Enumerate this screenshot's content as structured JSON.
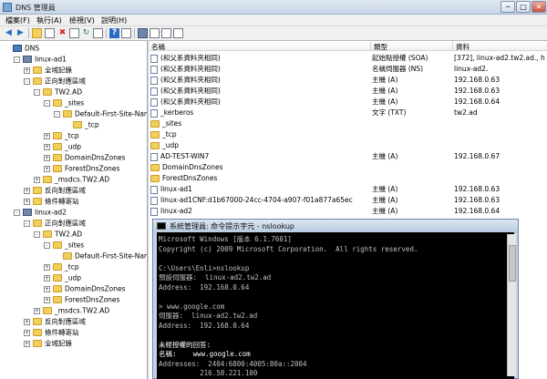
{
  "window": {
    "title": "DNS 管理員",
    "min": "─",
    "max": "□",
    "close": "✕"
  },
  "menu": [
    "檔案(F)",
    "執行(A)",
    "檢視(V)",
    "說明(H)"
  ],
  "toolbar_icons": [
    "back-arrow",
    "forward-arrow",
    "up-folder",
    "show-tree",
    "delete",
    "properties",
    "refresh",
    "export",
    "help",
    "help2",
    "server",
    "doc",
    "doc2",
    "doc3"
  ],
  "tree": [
    {
      "depth": 0,
      "exp": "",
      "icon": "dns",
      "label": "DNS"
    },
    {
      "depth": 1,
      "exp": "-",
      "icon": "server",
      "label": "linux-ad1"
    },
    {
      "depth": 2,
      "exp": "+",
      "icon": "folder",
      "label": "全域記錄"
    },
    {
      "depth": 2,
      "exp": "-",
      "icon": "folder",
      "label": "正向對應區域"
    },
    {
      "depth": 3,
      "exp": "-",
      "icon": "folder",
      "label": "TW2.AD"
    },
    {
      "depth": 4,
      "exp": "-",
      "icon": "folder",
      "label": "_sites"
    },
    {
      "depth": 5,
      "exp": "-",
      "icon": "folder",
      "label": "Default-First-Site-Name"
    },
    {
      "depth": 6,
      "exp": "",
      "icon": "folder",
      "label": "_tcp"
    },
    {
      "depth": 4,
      "exp": "+",
      "icon": "folder",
      "label": "_tcp"
    },
    {
      "depth": 4,
      "exp": "+",
      "icon": "folder",
      "label": "_udp"
    },
    {
      "depth": 4,
      "exp": "+",
      "icon": "folder",
      "label": "DomainDnsZones"
    },
    {
      "depth": 4,
      "exp": "+",
      "icon": "folder",
      "label": "ForestDnsZones"
    },
    {
      "depth": 3,
      "exp": "+",
      "icon": "folder",
      "label": "_msdcs.TW2.AD"
    },
    {
      "depth": 2,
      "exp": "+",
      "icon": "folder",
      "label": "反向對應區域"
    },
    {
      "depth": 2,
      "exp": "+",
      "icon": "folder",
      "label": "條件轉寄站"
    },
    {
      "depth": 1,
      "exp": "-",
      "icon": "server",
      "label": "linux-ad2"
    },
    {
      "depth": 2,
      "exp": "-",
      "icon": "folder",
      "label": "正向對應區域"
    },
    {
      "depth": 3,
      "exp": "-",
      "icon": "folder",
      "label": "TW2.AD"
    },
    {
      "depth": 4,
      "exp": "-",
      "icon": "folder",
      "label": "_sites"
    },
    {
      "depth": 5,
      "exp": "",
      "icon": "folder",
      "label": "Default-First-Site-Name"
    },
    {
      "depth": 4,
      "exp": "+",
      "icon": "folder",
      "label": "_tcp"
    },
    {
      "depth": 4,
      "exp": "+",
      "icon": "folder",
      "label": "_udp"
    },
    {
      "depth": 4,
      "exp": "+",
      "icon": "folder",
      "label": "DomainDnsZones"
    },
    {
      "depth": 4,
      "exp": "+",
      "icon": "folder",
      "label": "ForestDnsZones"
    },
    {
      "depth": 3,
      "exp": "+",
      "icon": "folder",
      "label": "_msdcs.TW2.AD"
    },
    {
      "depth": 2,
      "exp": "+",
      "icon": "folder",
      "label": "反向對應區域"
    },
    {
      "depth": 2,
      "exp": "+",
      "icon": "folder",
      "label": "條件轉寄站"
    },
    {
      "depth": 2,
      "exp": "+",
      "icon": "folder",
      "label": "全域記錄"
    }
  ],
  "columns": {
    "name": "名稱",
    "type": "類型",
    "data": "資料"
  },
  "records": [
    {
      "icon": "record",
      "name": "(和父系資料夾相同)",
      "type": "起始點授權 (SOA)",
      "data": "[372], linux-ad2.tw2.ad., h"
    },
    {
      "icon": "record",
      "name": "(和父系資料夾相同)",
      "type": "名稱伺服器 (NS)",
      "data": "linux-ad2."
    },
    {
      "icon": "record",
      "name": "(和父系資料夾相同)",
      "type": "主機 (A)",
      "data": "192.168.0.63"
    },
    {
      "icon": "record",
      "name": "(和父系資料夾相同)",
      "type": "主機 (A)",
      "data": "192.168.0.63"
    },
    {
      "icon": "record",
      "name": "(和父系資料夾相同)",
      "type": "主機 (A)",
      "data": "192.168.0.64"
    },
    {
      "icon": "record",
      "name": "_kerberos",
      "type": "文字 (TXT)",
      "data": "tw2.ad"
    },
    {
      "icon": "folder",
      "name": "_sites",
      "type": "",
      "data": ""
    },
    {
      "icon": "folder",
      "name": "_tcp",
      "type": "",
      "data": ""
    },
    {
      "icon": "folder",
      "name": "_udp",
      "type": "",
      "data": ""
    },
    {
      "icon": "record",
      "name": "AD-TEST-WIN7",
      "type": "主機 (A)",
      "data": "192.168.0.67"
    },
    {
      "icon": "folder",
      "name": "DomainDnsZones",
      "type": "",
      "data": ""
    },
    {
      "icon": "folder",
      "name": "ForestDnsZones",
      "type": "",
      "data": ""
    },
    {
      "icon": "record",
      "name": "linux-ad1",
      "type": "主機 (A)",
      "data": "192.168.0.63"
    },
    {
      "icon": "record",
      "name": "linux-ad1CNF:d1b67000-24cc-4704-a907-f01a877a65ec",
      "type": "主機 (A)",
      "data": "192.168.0.63"
    },
    {
      "icon": "record",
      "name": "linux-ad2",
      "type": "主機 (A)",
      "data": "192.168.0.64"
    }
  ],
  "cmd": {
    "title": "系統管理員: 命令提示字元 - nslookup",
    "lines": [
      {
        "text": "Microsoft Windows [版本 6.1.7601]",
        "bright": false
      },
      {
        "text": "Copyright (c) 2009 Microsoft Corporation.  All rights reserved.",
        "bright": false
      },
      {
        "text": "",
        "bright": false
      },
      {
        "text": "C:\\Users\\Enli>nslookup",
        "bright": false
      },
      {
        "text": "預設伺服器:  linux-ad2.tw2.ad",
        "bright": false
      },
      {
        "text": "Address:  192.168.0.64",
        "bright": false
      },
      {
        "text": "",
        "bright": false
      },
      {
        "text": "> www.google.com",
        "bright": false
      },
      {
        "text": "伺服器:  linux-ad2.tw2.ad",
        "bright": false
      },
      {
        "text": "Address:  192.168.0.64",
        "bright": false
      },
      {
        "text": "",
        "bright": false
      },
      {
        "text": "未經授權的回答:",
        "bright": true
      },
      {
        "text": "名稱:    www.google.com",
        "bright": true
      },
      {
        "text": "Addresses:  2404:6800:4005:80a::2004",
        "bright": false
      },
      {
        "text": "          216.58.221.100",
        "bright": false
      }
    ]
  },
  "colors": {
    "folder": "#f2cf5b",
    "console_bg": "#000000",
    "console_fg": "#c0c0c0",
    "window_frame": "#c4d3e6"
  }
}
